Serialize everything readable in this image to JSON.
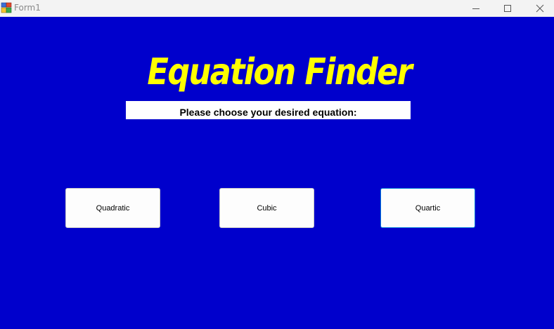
{
  "window": {
    "title": "Form1"
  },
  "main": {
    "heading": "Equation Finder",
    "prompt": "Please choose your desired equation:",
    "buttons": [
      {
        "label": "Quadratic"
      },
      {
        "label": "Cubic"
      },
      {
        "label": "Quartic"
      }
    ]
  },
  "colors": {
    "background": "#0000cc",
    "heading": "#ffff00",
    "focus_border": "#0078d7"
  },
  "icons": {
    "app": "form-app-icon",
    "minimize": "minimize-icon",
    "maximize": "maximize-icon",
    "close": "close-icon"
  }
}
